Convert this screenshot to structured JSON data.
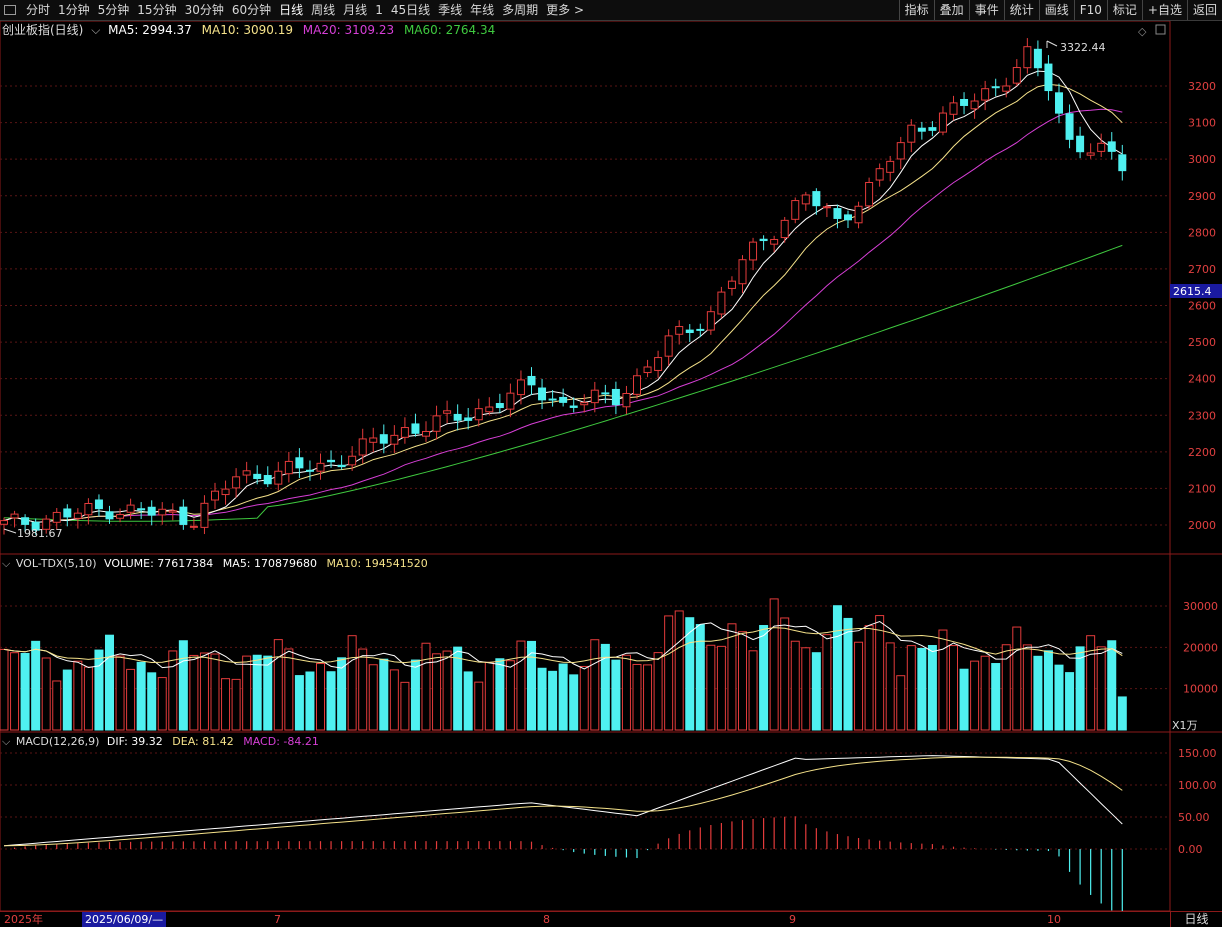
{
  "toolbar": {
    "periods": [
      "分时",
      "1分钟",
      "5分钟",
      "15分钟",
      "30分钟",
      "60分钟",
      "日线",
      "周线",
      "月线",
      "1",
      "45日线",
      "季线",
      "年线",
      "多周期",
      "更多 >"
    ],
    "active_period": "日线",
    "right": [
      "指标",
      "叠加",
      "事件",
      "统计",
      "画线",
      "F10",
      "标记",
      "+自选",
      "返回"
    ]
  },
  "main_panel": {
    "name": "创业板指(日线)",
    "ma5_label": "MA5: 2994.37",
    "ma10_label": "MA10: 3090.19",
    "ma20_label": "MA20: 3109.23",
    "ma60_label": "MA60: 2764.34",
    "colors": {
      "ma5": "#ffffff",
      "ma10": "#f5e28a",
      "ma20": "#d63fd6",
      "ma60": "#3fc93f",
      "up": "#e33b3b",
      "down": "#4ff0f0"
    },
    "y_ticks": [
      "3200",
      "3100",
      "3000",
      "2900",
      "2800",
      "2700",
      "2600",
      "2500",
      "2400",
      "2300",
      "2200",
      "2100",
      "2000"
    ],
    "current_price_tag": "2615.4",
    "high_label": "3322.44",
    "low_label": "1981.67"
  },
  "vol_panel": {
    "name": "VOL-TDX(5,10)",
    "volume_label": "VOLUME: 77617384",
    "ma5_label": "MA5: 170879680",
    "ma10_label": "MA10: 194541520",
    "y_ticks": [
      "30000",
      "20000",
      "10000"
    ],
    "unit": "X1万"
  },
  "macd_panel": {
    "name": "MACD(12,26,9)",
    "dif_label": "DIF: 39.32",
    "dea_label": "DEA: 81.42",
    "macd_label": "MACD: -84.21",
    "y_ticks": [
      "150.00",
      "100.00",
      "50.00",
      "0.00"
    ]
  },
  "xaxis": {
    "year_label": "2025年",
    "cursor_date": "2025/06/09/—",
    "months": [
      "7",
      "8",
      "9",
      "10"
    ],
    "period_button": "日线"
  },
  "chart_data": {
    "type": "candlestick",
    "high": 3322.44,
    "low": 1981.67,
    "ma60": {
      "start": 2050,
      "end": 2764.34
    },
    "last_closes": {
      "ma5": 2994.37,
      "ma10": 3090.19,
      "ma20": 3109.23,
      "ma60": 2764.34
    }
  }
}
